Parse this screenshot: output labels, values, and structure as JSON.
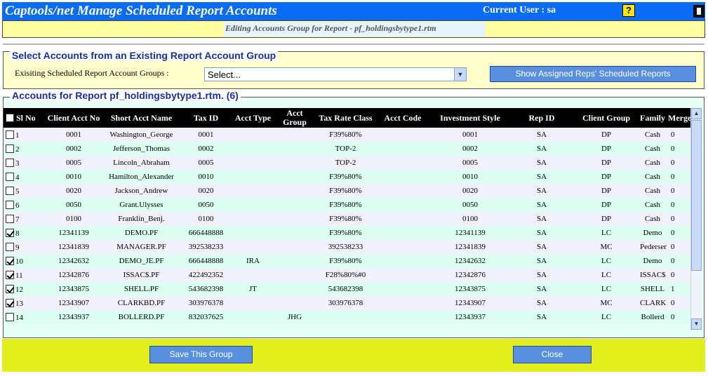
{
  "header": {
    "app_title": "Captools/net Manage Scheduled Report Accounts",
    "current_user": "Current User : sa",
    "help_icon": "?",
    "subtitle": "Editing Accounts Group for Report - pf_holdingsbytype1.rtm"
  },
  "existing_group": {
    "title": "Select Accounts from an Existing Report Account Group",
    "label": "Exisiting Scheduled Report Account Groups :",
    "select_value": "Select...",
    "show_button": "Show Assigned Reps' Scheduled Reports"
  },
  "accounts": {
    "title": "Accounts for Report pf_holdingsbytype1.rtm. (6)",
    "columns": [
      "Sl No",
      "Client Acct No",
      "Short Acct Name",
      "Tax ID",
      "Acct Type",
      "Acct Group",
      "Tax Rate Class",
      "Acct Code",
      "Investment Style",
      "Rep ID",
      "Client Group",
      "Family",
      "Merge By"
    ],
    "rows": [
      {
        "checked": false,
        "sl": "1",
        "acct_no": "0001",
        "name": "Washington_George",
        "tax_id": "0001",
        "type": "",
        "group": "",
        "tax_rate": "F39%80%",
        "code": "",
        "style": "0001",
        "rep": "SA",
        "client_group": "DP",
        "family": "Cash",
        "merge": "0"
      },
      {
        "checked": false,
        "sl": "2",
        "acct_no": "0002",
        "name": "Jefferson_Thomas",
        "tax_id": "0002",
        "type": "",
        "group": "",
        "tax_rate": "TOP-2",
        "code": "",
        "style": "0002",
        "rep": "SA",
        "client_group": "DP",
        "family": "Cash",
        "merge": "0"
      },
      {
        "checked": false,
        "sl": "3",
        "acct_no": "0005",
        "name": "Lincoln_Abraham",
        "tax_id": "0005",
        "type": "",
        "group": "",
        "tax_rate": "TOP-2",
        "code": "",
        "style": "0005",
        "rep": "SA",
        "client_group": "DP",
        "family": "Cash",
        "merge": "0"
      },
      {
        "checked": false,
        "sl": "4",
        "acct_no": "0010",
        "name": "Hamilton_Alexander",
        "tax_id": "0010",
        "type": "",
        "group": "",
        "tax_rate": "F39%80%",
        "code": "",
        "style": "0010",
        "rep": "SA",
        "client_group": "DP",
        "family": "Cash",
        "merge": "0"
      },
      {
        "checked": false,
        "sl": "5",
        "acct_no": "0020",
        "name": "Jackson_Andrew",
        "tax_id": "0020",
        "type": "",
        "group": "",
        "tax_rate": "F39%80%",
        "code": "",
        "style": "0020",
        "rep": "SA",
        "client_group": "DP",
        "family": "Cash",
        "merge": "0"
      },
      {
        "checked": false,
        "sl": "6",
        "acct_no": "0050",
        "name": "Grant.Ulysses",
        "tax_id": "0050",
        "type": "",
        "group": "",
        "tax_rate": "F39%80%",
        "code": "",
        "style": "0050",
        "rep": "SA",
        "client_group": "DP",
        "family": "Cash",
        "merge": "0"
      },
      {
        "checked": false,
        "sl": "7",
        "acct_no": "0100",
        "name": "Franklin_Benj.",
        "tax_id": "0100",
        "type": "",
        "group": "",
        "tax_rate": "F39%80%",
        "code": "",
        "style": "0100",
        "rep": "SA",
        "client_group": "DP",
        "family": "Cash",
        "merge": "0"
      },
      {
        "checked": true,
        "sl": "8",
        "acct_no": "12341139",
        "name": "DEMO.PF",
        "tax_id": "666448888",
        "type": "",
        "group": "",
        "tax_rate": "F39%80%",
        "code": "",
        "style": "12341139",
        "rep": "SA",
        "client_group": "LC",
        "family": "Demo",
        "merge": "0"
      },
      {
        "checked": false,
        "sl": "9",
        "acct_no": "12341839",
        "name": "MANAGER.PF",
        "tax_id": "392538233",
        "type": "",
        "group": "",
        "tax_rate": "392538233",
        "code": "",
        "style": "12341839",
        "rep": "SA",
        "client_group": "MC",
        "family": "Pedersen",
        "merge": "0"
      },
      {
        "checked": true,
        "sl": "10",
        "acct_no": "12342632",
        "name": "DEMO_JE.PF",
        "tax_id": "666448888",
        "type": "IRA",
        "group": "",
        "tax_rate": "F39%80%",
        "code": "",
        "style": "12342632",
        "rep": "SA",
        "client_group": "LC",
        "family": "Demo",
        "merge": "0"
      },
      {
        "checked": true,
        "sl": "11",
        "acct_no": "12342876",
        "name": "ISSAC$.PF",
        "tax_id": "422492352",
        "type": "",
        "group": "",
        "tax_rate": "F28%80%#0",
        "code": "",
        "style": "12342876",
        "rep": "SA",
        "client_group": "LC",
        "family": "ISSAC$",
        "merge": "0"
      },
      {
        "checked": true,
        "sl": "12",
        "acct_no": "12343875",
        "name": "SHELL.PF",
        "tax_id": "543682398",
        "type": "JT",
        "group": "",
        "tax_rate": "543682398",
        "code": "",
        "style": "12343875",
        "rep": "SA",
        "client_group": "LC",
        "family": "SHELL",
        "merge": "1"
      },
      {
        "checked": true,
        "sl": "13",
        "acct_no": "12343907",
        "name": "CLARKBD.PF",
        "tax_id": "303976378",
        "type": "",
        "group": "",
        "tax_rate": "303976378",
        "code": "",
        "style": "12343907",
        "rep": "SA",
        "client_group": "MC",
        "family": "CLARK",
        "merge": "0"
      },
      {
        "checked": false,
        "sl": "14",
        "acct_no": "12343937",
        "name": "BOLLERD.PF",
        "tax_id": "832037625",
        "type": "",
        "group": "JHG",
        "tax_rate": "",
        "code": "",
        "style": "12343937",
        "rep": "SA",
        "client_group": "LC",
        "family": "Bollerd",
        "merge": "0"
      }
    ]
  },
  "footer": {
    "save_button": "Save This Group",
    "close_button": "Close"
  },
  "colors": {
    "title_bar": "#0a6cf5",
    "header_row": "#000000",
    "footer": "#e3ef1c",
    "button": "#5a8fe0"
  }
}
